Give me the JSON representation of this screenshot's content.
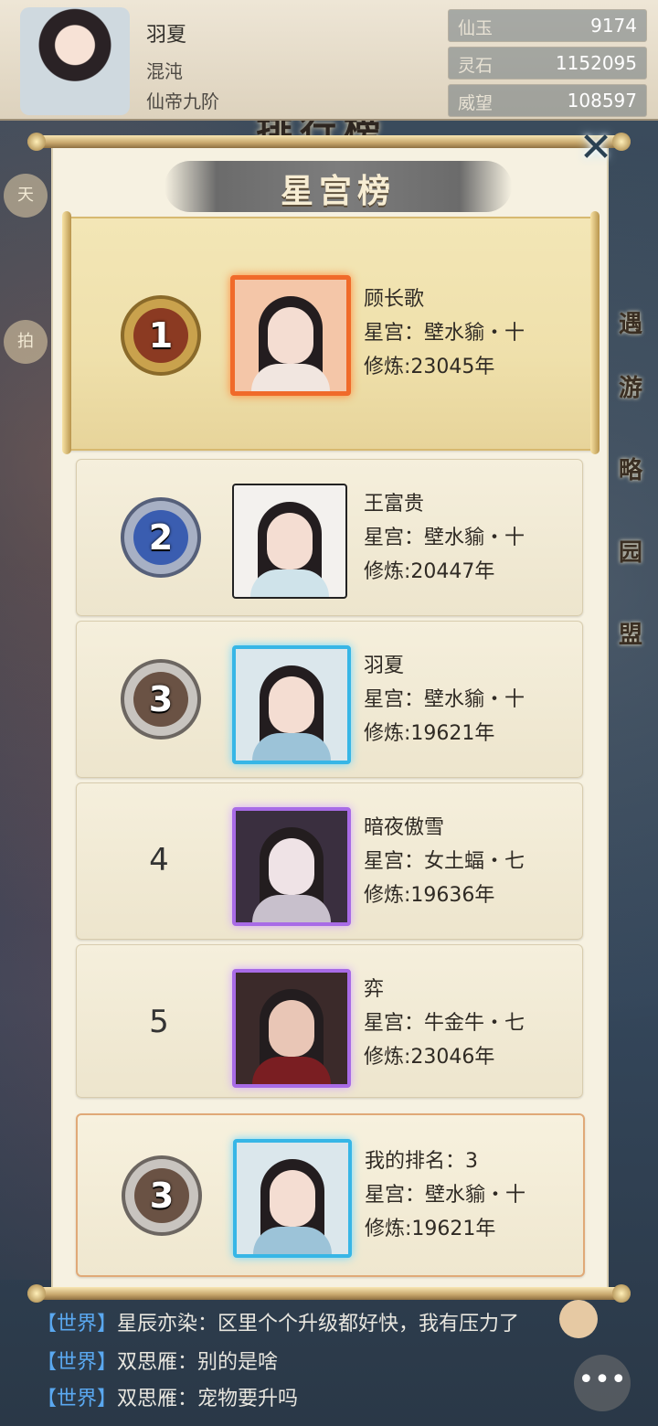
{
  "player": {
    "name": "羽夏",
    "realm": "混沌",
    "rank_title": "仙帝九阶"
  },
  "resources": [
    {
      "label": "仙玉",
      "value": "9174"
    },
    {
      "label": "灵石",
      "value": "1152095"
    },
    {
      "label": "威望",
      "value": "108597"
    }
  ],
  "background": {
    "title": "排行榜",
    "left_menu": [
      "天",
      "拍"
    ],
    "right_menu": [
      "遇",
      "游",
      "略",
      "园",
      "盟"
    ]
  },
  "modal": {
    "title": "星宫榜",
    "close_icon": "close-icon"
  },
  "rows": [
    {
      "rank": "1",
      "name": "顾长歌",
      "star": "星宫：壁水貐・十",
      "cultivation": "修炼:23045年",
      "frame": "#f06a2a"
    },
    {
      "rank": "2",
      "name": "王富贵",
      "star": "星宫：壁水貐・十",
      "cultivation": "修炼:20447年",
      "frame": "#3b3b3b"
    },
    {
      "rank": "3",
      "name": "羽夏",
      "star": "星宫：壁水貐・十",
      "cultivation": "修炼:19621年",
      "frame": "#37b6e6"
    },
    {
      "rank": "4",
      "name": "暗夜傲雪",
      "star": "星宫：女土蝠・七",
      "cultivation": "修炼:19636年",
      "frame": "#a86be6"
    },
    {
      "rank": "5",
      "name": "弈",
      "star": "星宫：牛金牛・七",
      "cultivation": "修炼:23046年",
      "frame": "#a86be6"
    }
  ],
  "mine": {
    "rank": "3",
    "label": "我的排名：3",
    "star": "星宫：壁水貐・十",
    "cultivation": "修炼:19621年"
  },
  "chat": [
    {
      "channel": "【世界】",
      "text": "星辰亦染：区里个个升级都好快，我有压力了"
    },
    {
      "channel": "【世界】",
      "text": "双思雁：别的是啥"
    },
    {
      "channel": "【世界】",
      "text": "双思雁：宠物要升吗"
    }
  ],
  "colors": {
    "gold": "#d7b970",
    "silver": "#9c9c9c",
    "blue_medal": "#3a5db0"
  }
}
